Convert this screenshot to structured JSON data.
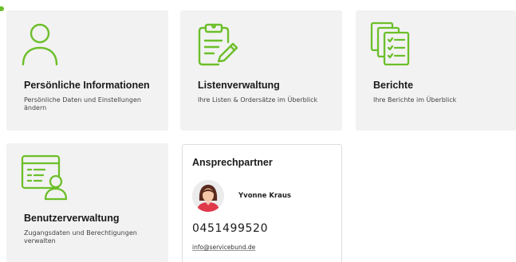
{
  "accent_color": "#6cbf2a",
  "tiles": [
    {
      "icon": "person-icon",
      "title": "Persönliche Informationen",
      "subtitle": "Persönliche Daten und Einstellungen ändern"
    },
    {
      "icon": "clipboard-edit-icon",
      "title": "Listenverwaltung",
      "subtitle": "Ihre Listen & Ordersätze im Überblick"
    },
    {
      "icon": "checklist-stack-icon",
      "title": "Berichte",
      "subtitle": "Ihre Berichte im Überblick"
    },
    {
      "icon": "user-management-icon",
      "title": "Benutzerverwaltung",
      "subtitle": "Zugangsdaten und Berechtigungen verwalten"
    }
  ],
  "contact": {
    "title": "Ansprechpartner",
    "name": "Yvonne Kraus",
    "phone": "0451499520",
    "email": "info@servicebund.de",
    "avatar_icon": "contact-avatar"
  }
}
